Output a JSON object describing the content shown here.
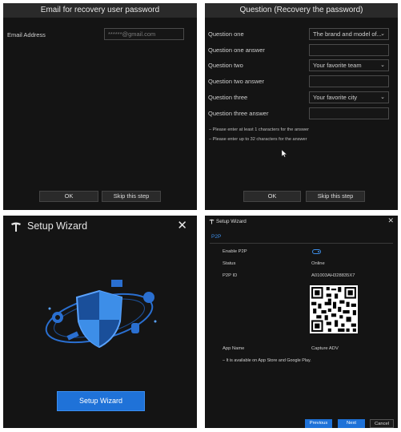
{
  "email_dialog": {
    "title": "Email for recovery user password",
    "email_label": "Email Address",
    "email_value": "******@gmail.com",
    "ok_label": "OK",
    "skip_label": "Skip this step"
  },
  "question_dialog": {
    "title": "Question (Recovery the password)",
    "rows": [
      {
        "label": "Question one",
        "value": "The brand and model of..."
      },
      {
        "label": "Question one answer",
        "value": ""
      },
      {
        "label": "Question two",
        "value": "Your favorite team"
      },
      {
        "label": "Question two answer",
        "value": ""
      },
      {
        "label": "Question three",
        "value": "Your favorite city"
      },
      {
        "label": "Question three answer",
        "value": ""
      }
    ],
    "hint_min": "– Please enter at least 1 characters for the answer",
    "hint_max": "– Please enter up to 32 characters for the answer",
    "ok_label": "OK",
    "skip_label": "Skip this step"
  },
  "setup_wizard": {
    "title": "Setup Wizard",
    "close_glyph": "✕",
    "button_label": "Setup Wizard"
  },
  "p2p_wizard": {
    "title": "Setup Wizard",
    "close_glyph": "✕",
    "tab_label": "P2P",
    "enable_label": "Enable P2P",
    "enable_on": true,
    "status_label": "Status",
    "status_value": "Online",
    "p2p_id_label": "P2P ID",
    "p2p_id_value": "A01003AH328835X7",
    "app_name_label": "App Name",
    "app_name_value": "Capture ADV",
    "note": "– It is available on App Store and Google Play.",
    "previous_label": "Previous",
    "next_label": "Next",
    "cancel_label": "Cancel"
  },
  "colors": {
    "accent": "#1f72d8",
    "panel_bg": "#141414",
    "title_bar": "#2a2a2a"
  }
}
